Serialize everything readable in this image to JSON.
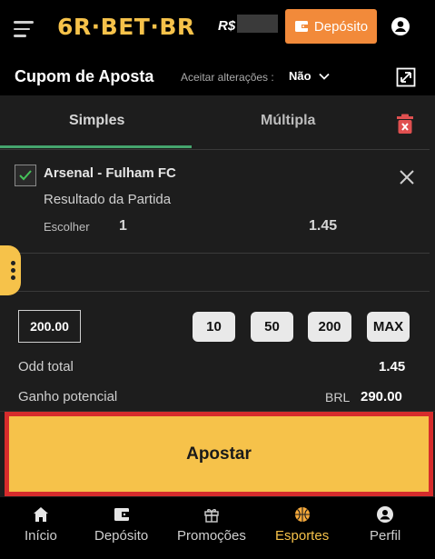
{
  "topbar": {
    "logo": "6R·BET·BR",
    "balance_prefix": "R$",
    "deposit_label": "Depósito"
  },
  "coupon": {
    "title": "Cupom de Aposta",
    "accept_label": "Aceitar alterações :",
    "accept_value": "Não"
  },
  "tabs": {
    "simples": "Simples",
    "multipla": "Múltipla"
  },
  "bet": {
    "match": "Arsenal - Fulham FC",
    "market": "Resultado da Partida",
    "pick_label": "Escolher",
    "pick_value": "1",
    "odd": "1.45",
    "checked": true
  },
  "stake": {
    "amount": "200.00",
    "quick_amounts": [
      "10",
      "50",
      "200",
      "MAX"
    ]
  },
  "summary": {
    "odd_total_label": "Odd total",
    "odd_total_value": "1.45",
    "gain_label": "Ganho potencial",
    "gain_currency": "BRL",
    "gain_value": "290.00"
  },
  "action": {
    "apostar_label": "Apostar"
  },
  "nav": {
    "items": [
      {
        "label": "Início",
        "icon": "home-icon"
      },
      {
        "label": "Depósito",
        "icon": "wallet-icon"
      },
      {
        "label": "Promoções",
        "icon": "gift-icon"
      },
      {
        "label": "Esportes",
        "icon": "basketball-icon",
        "active": true
      },
      {
        "label": "Perfil",
        "icon": "user-icon"
      }
    ]
  },
  "colors": {
    "accent": "#f6c24a",
    "deposit": "#f28a3a",
    "tab_underline": "#45a56e",
    "highlight_frame": "#d62c2c"
  }
}
